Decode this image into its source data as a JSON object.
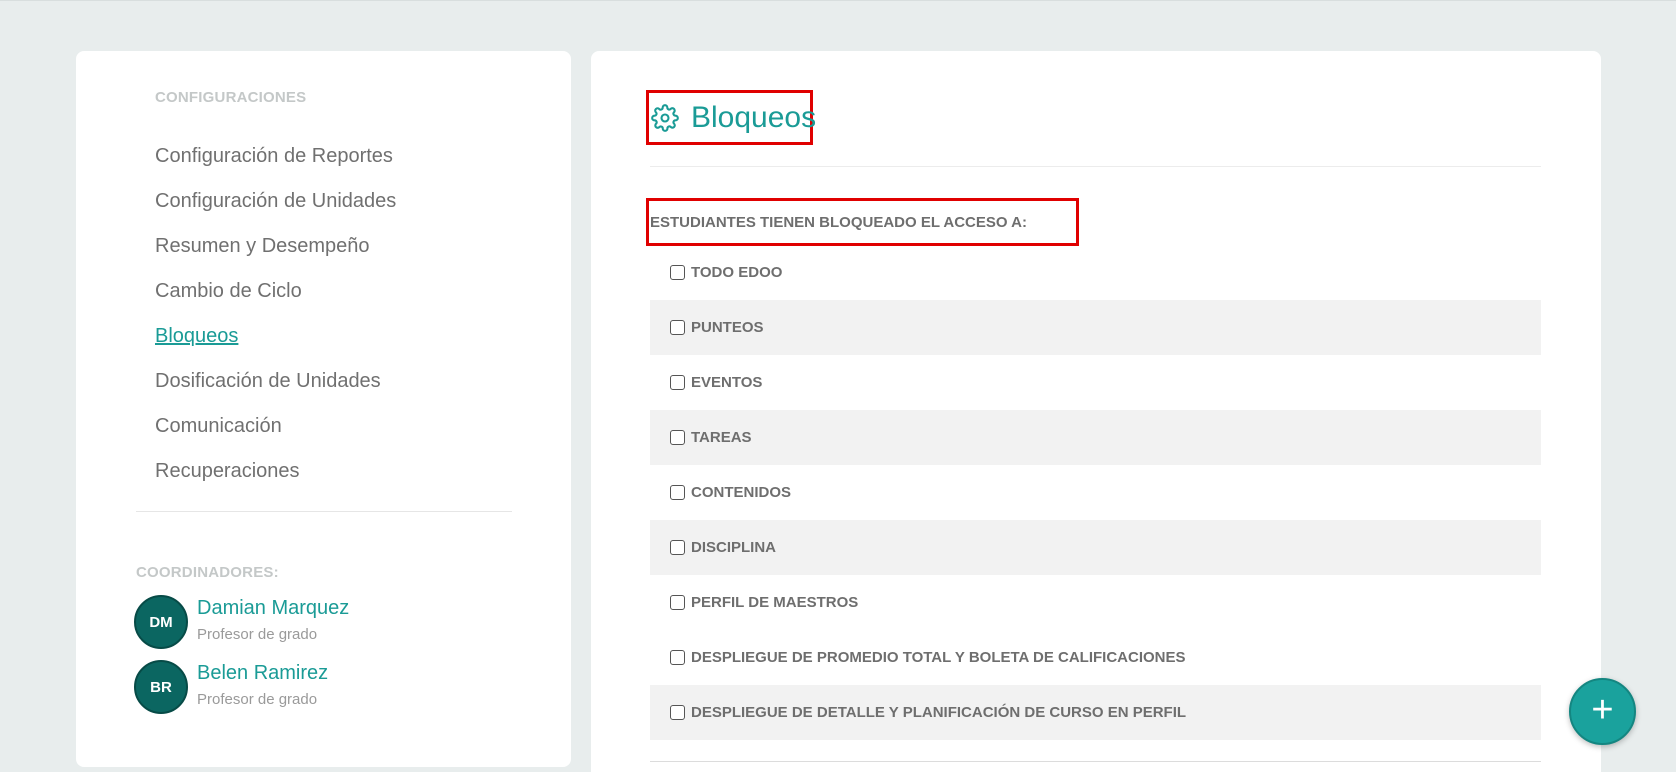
{
  "sidebar": {
    "config_heading": "CONFIGURACIONES",
    "items": [
      {
        "label": "Configuración de Reportes"
      },
      {
        "label": "Configuración de Unidades"
      },
      {
        "label": "Resumen y Desempeño"
      },
      {
        "label": "Cambio de Ciclo"
      },
      {
        "label": "Bloqueos",
        "active": true
      },
      {
        "label": "Dosificación de Unidades"
      },
      {
        "label": "Comunicación"
      },
      {
        "label": "Recuperaciones"
      }
    ],
    "coordinators_heading": "COORDINADORES:",
    "coordinators": [
      {
        "initials": "DM",
        "name": "Damian Marquez",
        "role": "Profesor de grado"
      },
      {
        "initials": "BR",
        "name": "Belen Ramirez",
        "role": "Profesor de grado"
      }
    ]
  },
  "main": {
    "title": "Bloqueos",
    "title_icon": "gear-icon",
    "subtitle": "ESTUDIANTES TIENEN BLOQUEADO EL ACCESO A:",
    "options": [
      {
        "label": "TODO EDOO",
        "checked": false
      },
      {
        "label": "PUNTEOS",
        "checked": false
      },
      {
        "label": "EVENTOS",
        "checked": false
      },
      {
        "label": "TAREAS",
        "checked": false
      },
      {
        "label": "CONTENIDOS",
        "checked": false
      },
      {
        "label": "DISCIPLINA",
        "checked": false
      },
      {
        "label": "PERFIL DE MAESTROS",
        "checked": false
      },
      {
        "label": "DESPLIEGUE DE PROMEDIO TOTAL Y BOLETA DE CALIFICACIONES",
        "checked": false
      },
      {
        "label": "DESPLIEGUE DE DETALLE Y PLANIFICACIÓN DE CURSO EN PERFIL",
        "checked": false
      }
    ]
  },
  "fab": {
    "label": "+",
    "icon": "plus-icon"
  },
  "colors": {
    "accent": "#1a9b96",
    "highlight_border": "#e00000",
    "avatar_bg": "#0b6661"
  }
}
